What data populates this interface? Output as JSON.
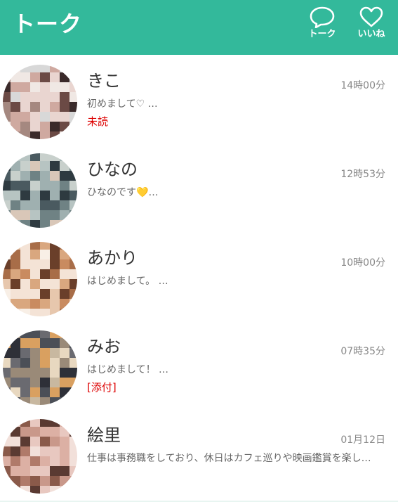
{
  "header": {
    "title": "トーク",
    "talk_label": "トーク",
    "like_label": "いいね",
    "bg_color": "#33b99b"
  },
  "conversations": [
    {
      "name": "きこ",
      "time": "14時00分",
      "preview": "初めまして♡ …",
      "badge": "未読",
      "palette": [
        "#e9d5d0",
        "#cfa9a0",
        "#6b4a45",
        "#3a2a2a",
        "#d8d8d8",
        "#f0e8e4",
        "#a58880"
      ]
    },
    {
      "name": "ひなの",
      "time": "12時53分",
      "preview_text": "ひなのです",
      "preview_emoji": "💛",
      "preview_suffix": "…",
      "badge": "",
      "palette": [
        "#9fb0b0",
        "#6f8284",
        "#c8d0cc",
        "#4a5a60",
        "#d9c7b8",
        "#2e3a40",
        "#b7c4c2"
      ]
    },
    {
      "name": "あかり",
      "time": "10時00分",
      "preview": "はじめまして。 …",
      "badge": "",
      "palette": [
        "#f4e3d6",
        "#d9a77f",
        "#a86d48",
        "#6a3f2a",
        "#f8efe6",
        "#c98b60",
        "#e7c7ad"
      ]
    },
    {
      "name": "みお",
      "time": "07時35分",
      "preview": "はじめまして！ …",
      "badge": "[添付]",
      "palette": [
        "#9a8a78",
        "#4b4f57",
        "#c8b8a0",
        "#2e3038",
        "#d9a060",
        "#e8d8c0",
        "#6a6a70"
      ]
    },
    {
      "name": "絵里",
      "time": "01月12日",
      "preview": "仕事は事務職をしており、休日はカフェ巡りや映画鑑賞を楽し…",
      "badge": "",
      "palette": [
        "#e8c8c0",
        "#c9988a",
        "#8a5a4a",
        "#f2e0da",
        "#b07a6a",
        "#5a3a32",
        "#dcb0a4"
      ]
    }
  ]
}
